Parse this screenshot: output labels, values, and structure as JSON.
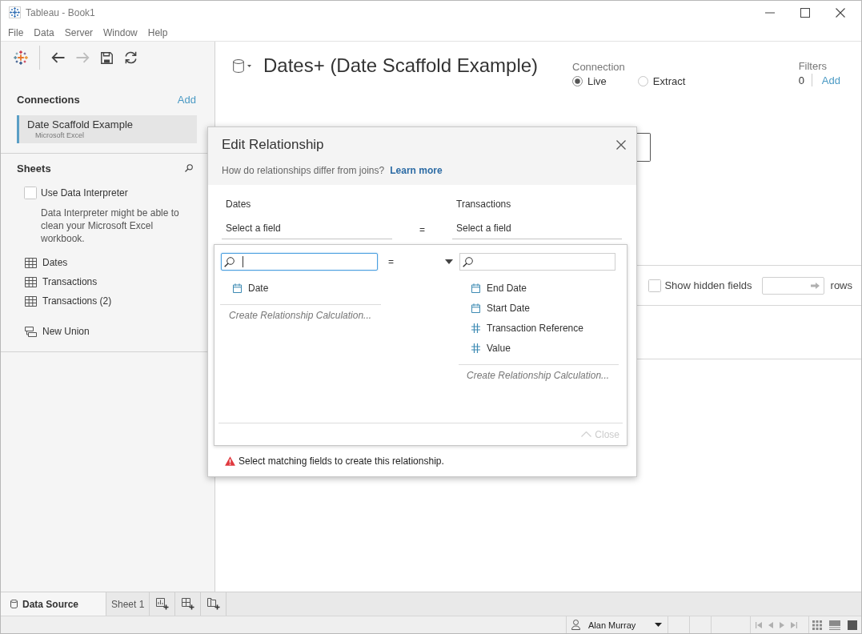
{
  "window": {
    "title": "Tableau - Book1"
  },
  "menu": [
    "File",
    "Data",
    "Server",
    "Window",
    "Help"
  ],
  "toolbar": [
    {
      "kind": "back",
      "disabled": false
    },
    {
      "kind": "forward",
      "disabled": true
    },
    {
      "kind": "save",
      "disabled": false
    },
    {
      "kind": "refresh",
      "disabled": false
    }
  ],
  "connections": {
    "title": "Connections",
    "add": "Add",
    "items": [
      {
        "name": "Date Scaffold Example",
        "type": "Microsoft Excel",
        "selected": true
      }
    ]
  },
  "sheets": {
    "title": "Sheets",
    "interpreter": {
      "label": "Use Data Interpreter",
      "checked": false
    },
    "note": "Data Interpreter might be able to clean your Microsoft Excel workbook.",
    "items": [
      {
        "label": "Dates",
        "kind": "table"
      },
      {
        "label": "Transactions",
        "kind": "table"
      },
      {
        "label": "Transactions (2)",
        "kind": "table"
      },
      {
        "label": "New Union",
        "kind": "union"
      }
    ]
  },
  "data_source": {
    "title": "Dates+ (Date Scaffold Example)",
    "connection": {
      "label": "Connection",
      "options": [
        {
          "label": "Live",
          "selected": true
        },
        {
          "label": "Extract",
          "selected": false
        }
      ]
    },
    "filters": {
      "label": "Filters",
      "count": "0",
      "add": "Add"
    }
  },
  "grid": {
    "show_hidden_fields": {
      "label": "Show hidden fields",
      "checked": false
    },
    "rows_label": "rows"
  },
  "dialog": {
    "title": "Edit Relationship",
    "help": "How do relationships differ from joins?",
    "link": "Learn more",
    "left": {
      "table": "Dates",
      "placeholder": "Select a field"
    },
    "operator": "=",
    "right": {
      "table": "Transactions",
      "placeholder": "Select a field"
    },
    "picker": {
      "left": {
        "focused": true,
        "fields": [
          {
            "name": "Date",
            "kind": "date"
          }
        ],
        "calculation": "Create Relationship Calculation..."
      },
      "operator": "=",
      "right": {
        "focused": false,
        "fields": [
          {
            "name": "End Date",
            "kind": "date"
          },
          {
            "name": "Start Date",
            "kind": "date"
          },
          {
            "name": "Transaction Reference",
            "kind": "number"
          },
          {
            "name": "Value",
            "kind": "number"
          }
        ],
        "calculation": "Create Relationship Calculation..."
      },
      "close": {
        "label": "Close",
        "disabled": true
      }
    },
    "warning": "Select matching fields to create this relationship."
  },
  "tabs": [
    {
      "label": "Data Source",
      "kind": "data_source",
      "selected": true
    },
    {
      "label": "Sheet 1",
      "kind": "sheet",
      "selected": false
    }
  ],
  "status_bar": {
    "user": "Alan Murray"
  }
}
